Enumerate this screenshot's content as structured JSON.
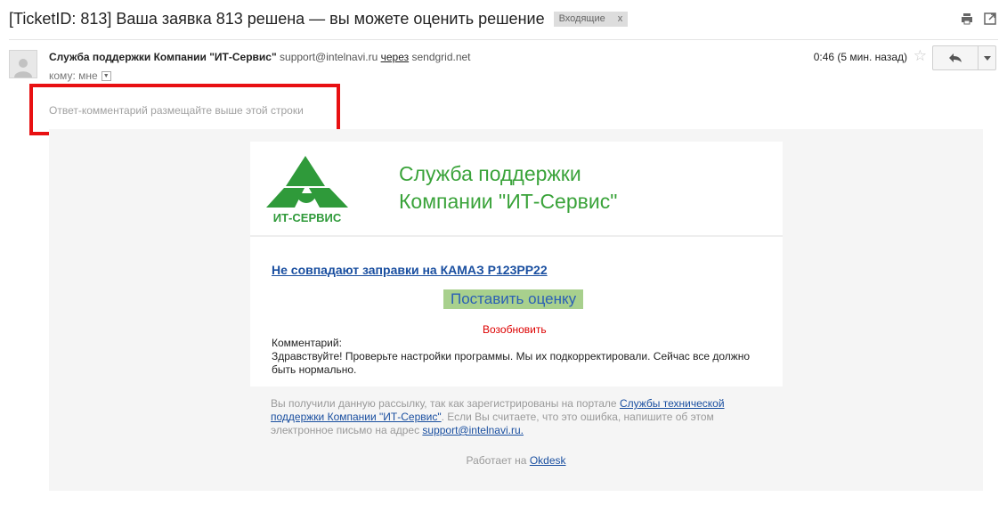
{
  "subject": "[TicketID: 813] Ваша заявка 813 решена — вы можете оценить решение",
  "label": {
    "text": "Входящие",
    "remove": "x"
  },
  "sender": {
    "name": "Служба поддержки Компании \"ИТ-Сервис\"",
    "email": "support@intelnavi.ru",
    "via": "через",
    "via_domain": "sendgrid.net"
  },
  "recipient": {
    "text": "кому: мне"
  },
  "time": "0:46 (5 мин. назад)",
  "reply_hint": "Ответ-комментарий размещайте выше этой строки",
  "card": {
    "logo_text": "ИТ-СЕРВИС",
    "title_line1": "Служба поддержки",
    "title_line2": "Компании \"ИТ-Сервис\"",
    "ticket_link": "Не совпадают заправки на КАМАЗ Р123РР22",
    "rate_button": "Поставить оценку",
    "reopen": "Возобновить",
    "comment_label": "Комментарий:",
    "comment_text": "Здравствуйте! Проверьте настройки программы. Мы их подкорректировали. Сейчас все должно быть нормально."
  },
  "footer": {
    "text_before": "Вы получили данную рассылку, так как зарегистрированы на портале ",
    "portal_link": "Службы технической поддержки Компании \"ИТ-Сервис\"",
    "text_middle": ". Если Вы считаете, что это ошибка, напишите об этом электронное письмо на адрес ",
    "email_link": "support@intelnavi.ru."
  },
  "powered": {
    "prefix": "Работает на",
    "link": "Okdesk"
  },
  "colors": {
    "brand_green": "#3aa33a",
    "rate_button_bg": "#a8d08d",
    "link_blue": "#1a4fa0",
    "reopen_red": "#dd0000",
    "highlight_frame": "#e81012"
  },
  "icons": [
    "print-icon",
    "new-window-icon",
    "avatar-icon",
    "star-icon",
    "reply-icon",
    "more-icon",
    "dropdown-icon",
    "logo-icon"
  ]
}
